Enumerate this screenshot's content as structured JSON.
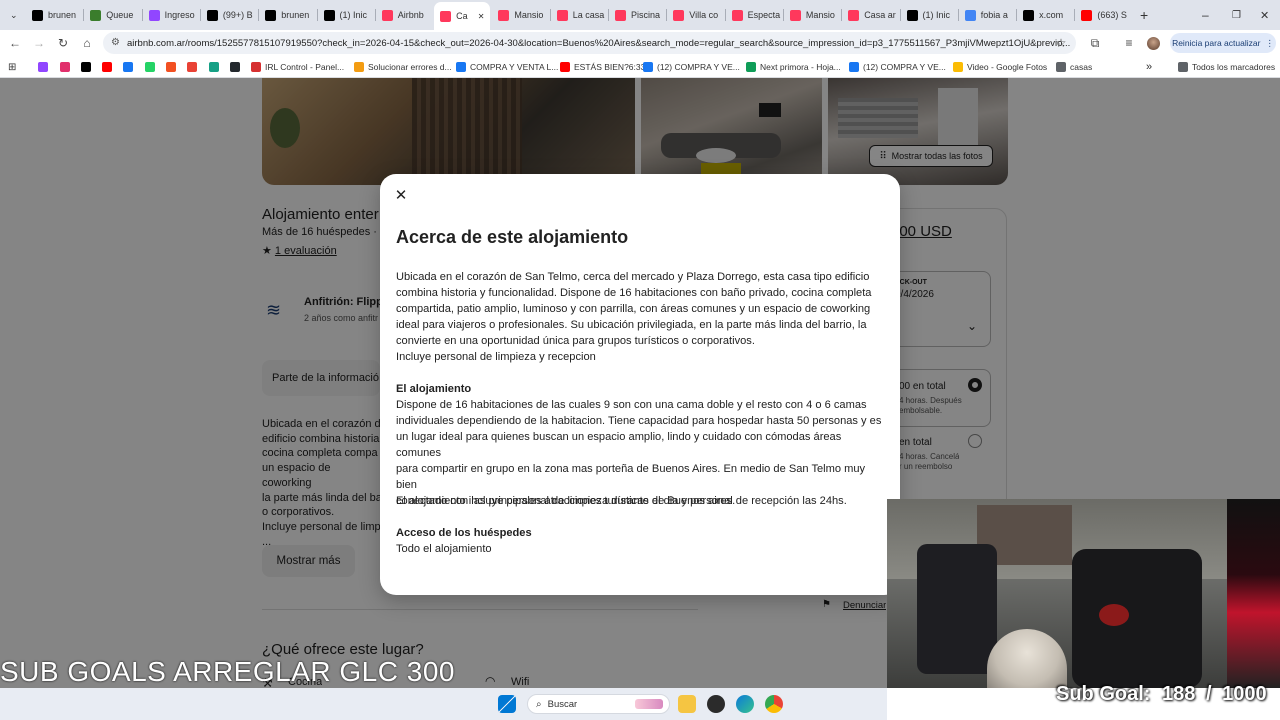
{
  "tabs": [
    {
      "label": "brunen",
      "icon": "x-icon",
      "color": "#000000"
    },
    {
      "label": "Queue",
      "icon": "q-icon",
      "color": "#3a7d2c"
    },
    {
      "label": "Ingreso",
      "icon": "twitch-icon",
      "color": "#9146ff"
    },
    {
      "label": "(99+) B",
      "icon": "tiktok-icon",
      "color": "#000000"
    },
    {
      "label": "brunen",
      "icon": "x-icon",
      "color": "#000000"
    },
    {
      "label": "(1) Inic",
      "icon": "x-icon",
      "color": "#000000"
    },
    {
      "label": "Airbnb",
      "icon": "airbnb-icon",
      "color": "#ff385c"
    },
    {
      "label": "Ca",
      "icon": "airbnb-icon",
      "color": "#ff385c"
    },
    {
      "label": "Mansio",
      "icon": "airbnb-icon",
      "color": "#ff385c"
    },
    {
      "label": "La casa",
      "icon": "airbnb-icon",
      "color": "#ff385c"
    },
    {
      "label": "Piscina",
      "icon": "airbnb-icon",
      "color": "#ff385c"
    },
    {
      "label": "Villa co",
      "icon": "airbnb-icon",
      "color": "#ff385c"
    },
    {
      "label": "Especta",
      "icon": "airbnb-icon",
      "color": "#ff385c"
    },
    {
      "label": "Mansio",
      "icon": "airbnb-icon",
      "color": "#ff385c"
    },
    {
      "label": "Casa ar",
      "icon": "airbnb-icon",
      "color": "#ff385c"
    },
    {
      "label": "(1) Inic",
      "icon": "x-icon",
      "color": "#000000"
    },
    {
      "label": "fobia a",
      "icon": "google-icon",
      "color": "#4285f4"
    },
    {
      "label": "x.com",
      "icon": "x-icon",
      "color": "#000000"
    },
    {
      "label": "(663) S",
      "icon": "youtube-icon",
      "color": "#ff0000"
    }
  ],
  "address_bar": {
    "url": "airbnb.com.ar/rooms/1525577815107919550?check_in=2026-04-15&check_out=2026-04-30&location=Buenos%20Aires&search_mode=regular_search&source_impression_id=p3_1775511567_P3mjiVMwepzt1OjU&previo..."
  },
  "update_button": "Reinicia para actualizar",
  "bookmarks": [
    {
      "label": "",
      "icon": "twitch-icon",
      "color": "#9146ff"
    },
    {
      "label": "",
      "icon": "instagram-icon",
      "color": "#e1306c"
    },
    {
      "label": "",
      "icon": "x-icon",
      "color": "#000000"
    },
    {
      "label": "",
      "icon": "youtube-icon",
      "color": "#ff0000"
    },
    {
      "label": "",
      "icon": "facebook-icon",
      "color": "#1877f2"
    },
    {
      "label": "",
      "icon": "whatsapp-icon",
      "color": "#25d366"
    },
    {
      "label": "",
      "icon": "microsoft-icon",
      "color": "#f25022"
    },
    {
      "label": "",
      "icon": "gallery-icon",
      "color": "#e94235"
    },
    {
      "label": "",
      "icon": "kick-icon",
      "color": "#16a085"
    },
    {
      "label": "",
      "icon": "github-icon",
      "color": "#24292e"
    },
    {
      "label": "IRL Control - Panel...",
      "icon": "irl-icon",
      "color": "#d63031"
    },
    {
      "label": "Solucionar errores d...",
      "icon": "windows-icon",
      "color": "#f39c12"
    },
    {
      "label": "COMPRA Y VENTA L...",
      "icon": "facebook-icon",
      "color": "#1877f2"
    },
    {
      "label": "ESTÁS BIEN?6:33",
      "icon": "youtube-icon",
      "color": "#ff0000"
    },
    {
      "label": "(12) COMPRA Y VE...",
      "icon": "facebook-icon",
      "color": "#1877f2"
    },
    {
      "label": "Next primora - Hoja...",
      "icon": "sheets-icon",
      "color": "#0f9d58"
    },
    {
      "label": "(12) COMPRA Y VE...",
      "icon": "facebook-icon",
      "color": "#1877f2"
    },
    {
      "label": "Video - Google Fotos",
      "icon": "photos-icon",
      "color": "#fbbc04"
    },
    {
      "label": "casas",
      "icon": "folder-icon",
      "color": "#5f6368"
    },
    {
      "label": "Todos los marcadores",
      "icon": "folder-icon",
      "color": "#5f6368"
    }
  ],
  "listing": {
    "show_photos": "Mostrar todas las fotos",
    "title": "Alojamiento enter",
    "guests": "Más de 16 huéspedes · 1(",
    "reviews": "1 evaluación",
    "host": "Anfitrión: Flippi",
    "host_time": "2 años como anfitr",
    "info_section": "Parte de la informació",
    "description_lines": [
      "Ubicada en el corazón d",
      "edificio combina historia",
      "cocina completa compa",
      "un espacio de coworking",
      "la parte más linda del ba",
      "o corporativos.",
      "Incluye personal de limp",
      "..."
    ],
    "show_more": "Mostrar más",
    "offers_heading": "¿Qué ofrece este lugar?",
    "amenity_kitchen": "Cocina",
    "amenity_wifi": "Wifi",
    "report": "Denunciar",
    "price": "200 USD",
    "checkout_label": "ECK-OUT",
    "checkout_date": "0/4/2026",
    "option1_price": "00 en total",
    "option1_line1": "4 horas. Después",
    "option1_line2": "embolsable.",
    "option2_price": "en total",
    "option2_line1": "4 horas. Cancelá",
    "option2_line2": "r un reembolso"
  },
  "modal": {
    "title": "Acerca de este alojamiento",
    "intro": [
      "Ubicada en el corazón de San Telmo, cerca del mercado y Plaza Dorrego, esta casa tipo edificio",
      "combina historia y funcionalidad. Dispone de 16 habitaciones con baño privado, cocina completa",
      "compartida, patio amplio, luminoso y con parrilla, con áreas comunes y un espacio de coworking",
      "ideal para viajeros o profesionales. Su ubicación privilegiada, en la parte más linda del barrio, la",
      "convierte en una oportunidad única para grupos turísticos o corporativos.",
      "Incluye personal de limpieza y recepcion"
    ],
    "section1_heading": "El alojamiento",
    "section1_body": [
      "Dispone de 16 habitaciones de las cuales 9 son con una cama doble y el resto con 4 o 6 camas",
      "individuales dependiendo de la habitacion. Tiene capacidad para hospedar hasta 50 personas y es",
      "un lugar ideal para quienes buscan un espacio amplio, lindo y cuidado con cómodas áreas comunes",
      "para compartir en grupo en la zona mas porteña de Buenos Aires. En medio de San Telmo muy bien",
      "conectado con las principales atracciones turísticas de Buenos aires."
    ],
    "section1_extra": "El alojamiento incluye personal de limpieza durante el dia y personal de recepción las 24hs.",
    "section2_heading": "Acceso de los huéspedes",
    "section2_body": "Todo el alojamiento"
  },
  "stream": {
    "sub_goals_text": "SUB GOALS ARREGLAR GLC  300",
    "sub_goal_label": "Sub Goal:",
    "sub_goal_current": "188",
    "sub_goal_separator": "/",
    "sub_goal_target": "1000"
  },
  "taskbar": {
    "search_placeholder": "Buscar"
  },
  "colors": {
    "brand": "#ff385c",
    "overlay": "rgba(0,0,0,0.48)",
    "tab_strip": "#dfe3eb"
  }
}
